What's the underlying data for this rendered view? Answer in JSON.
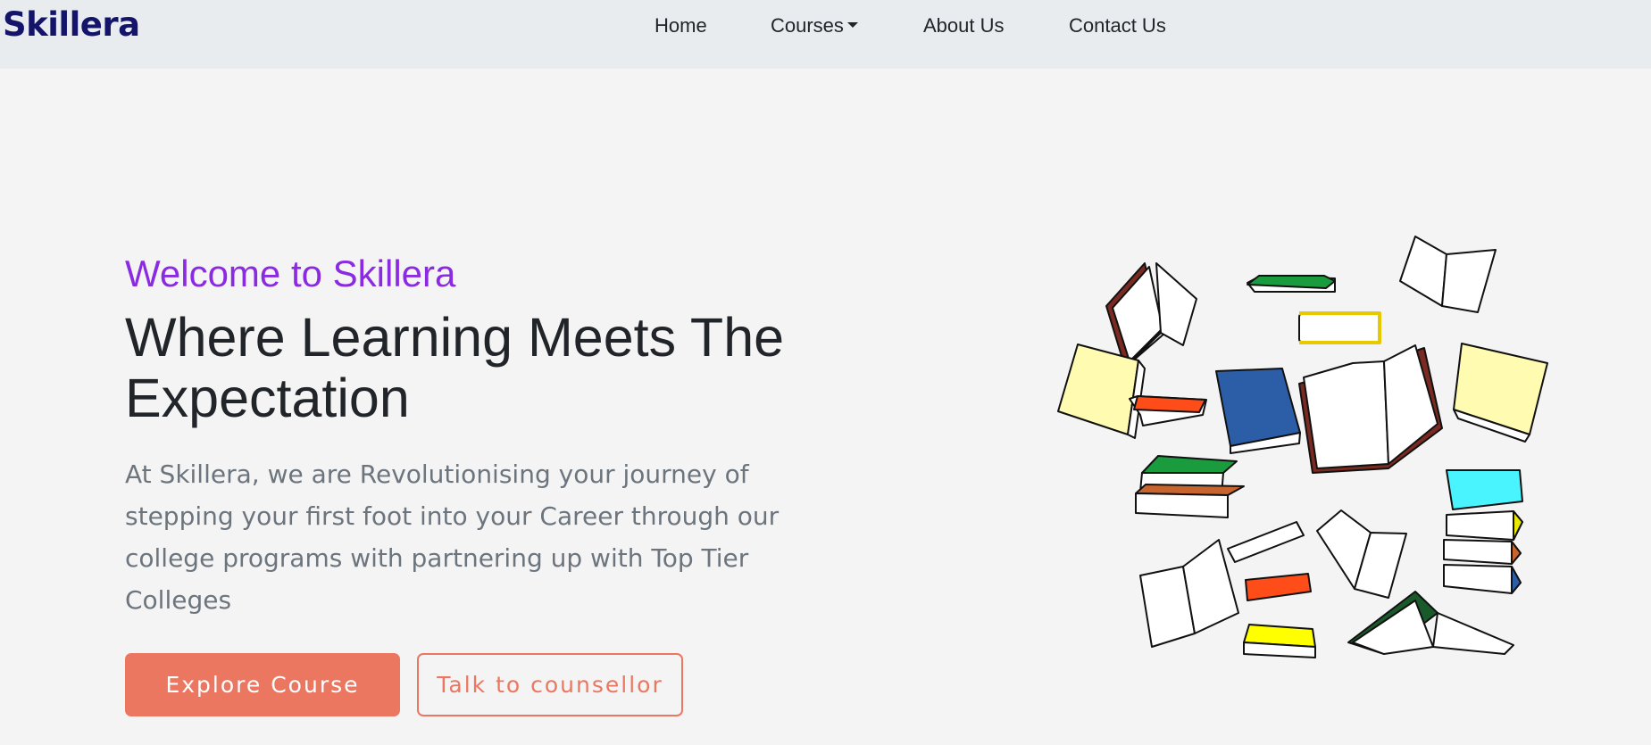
{
  "brand": {
    "name": "Skillera"
  },
  "nav": {
    "home": "Home",
    "courses": "Courses",
    "about": "About Us",
    "contact": "Contact Us"
  },
  "hero": {
    "welcome": "Welcome to Skillera",
    "headline_line1": "Where Learning Meets The",
    "headline_line2": "Expectation",
    "description": "At Skillera, we are Revolutionising your journey of stepping your first foot into your Career through our college programs with partnering up with Top Tier Colleges",
    "primary_button": "Explore Course",
    "secondary_button": "Talk to counsellor"
  },
  "colors": {
    "accent": "#eb7760",
    "welcome_text": "#8a2be2",
    "brand_text": "#14146b",
    "navbar_bg": "#e9ecef"
  }
}
